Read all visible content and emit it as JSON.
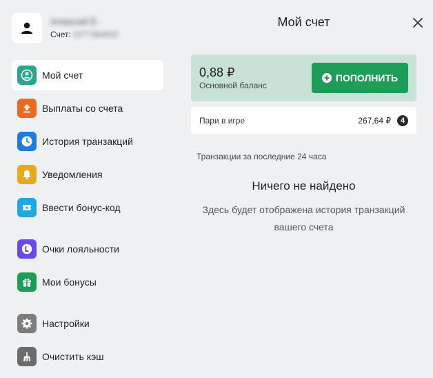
{
  "header": {
    "user_name": "Алексей Е.",
    "account_label": "Счет:",
    "account_number": "1077384920",
    "title": "Мой счет"
  },
  "sidebar": {
    "items": [
      {
        "label": "Мой счет",
        "icon": "user-circle-icon",
        "color": "#2aa58e",
        "active": true
      },
      {
        "label": "Выплаты со счета",
        "icon": "upload-icon",
        "color": "#ea6a20",
        "active": false
      },
      {
        "label": "История транзакций",
        "icon": "clock-icon",
        "color": "#1e7be0",
        "active": false
      },
      {
        "label": "Уведомления",
        "icon": "bell-icon",
        "color": "#e8a91e",
        "active": false
      },
      {
        "label": "Ввести бонус-код",
        "icon": "ticket-icon",
        "color": "#1fa8e4",
        "active": false
      },
      {
        "label": "Очки лояльности",
        "icon": "loyalty-icon",
        "color": "#6a49e6",
        "active": false
      },
      {
        "label": "Мои бонусы",
        "icon": "gift-icon",
        "color": "#1e9d58",
        "active": false
      },
      {
        "label": "Настройки",
        "icon": "gear-icon",
        "color": "#7d7d7d",
        "active": false
      },
      {
        "label": "Очистить кэш",
        "icon": "broom-icon",
        "color": "#6b6b6b",
        "active": false
      }
    ]
  },
  "balance": {
    "amount": "0,88 ₽",
    "label": "Основной баланс",
    "topup_label": "ПОПОЛНИТЬ"
  },
  "bets": {
    "label": "Пари в игре",
    "amount": "267,64 ₽",
    "count": "4"
  },
  "transactions": {
    "header": "Транзакции за последние 24 часа",
    "empty_title": "Ничего не найдено",
    "empty_description": "Здесь будет отображена история транзакций вашего счета"
  },
  "colors": {
    "accent_green": "#1e9d58",
    "balance_bg": "#c8e2d7"
  }
}
